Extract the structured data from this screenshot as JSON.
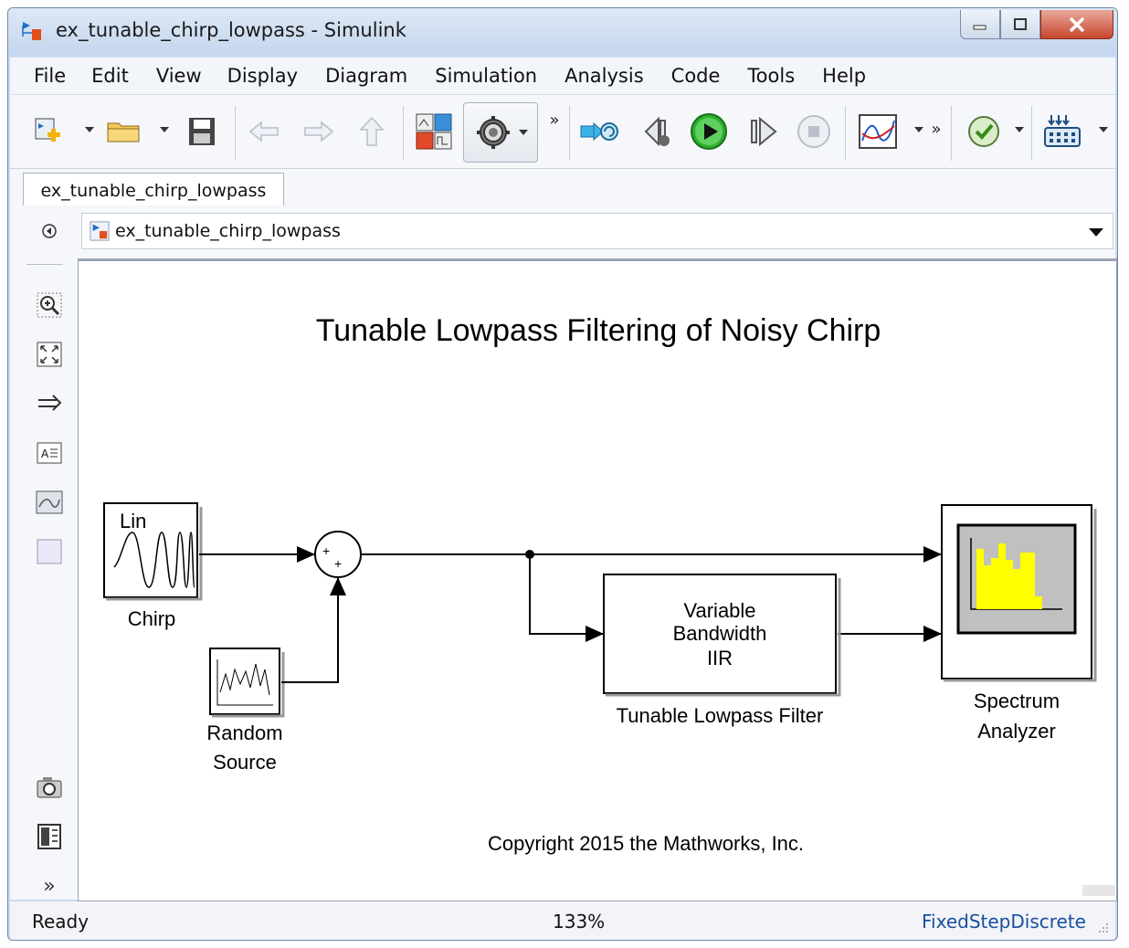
{
  "window": {
    "title": "ex_tunable_chirp_lowpass - Simulink"
  },
  "menu": [
    "File",
    "Edit",
    "View",
    "Display",
    "Diagram",
    "Simulation",
    "Analysis",
    "Code",
    "Tools",
    "Help"
  ],
  "toolbar": {
    "icons": [
      "new-model-icon",
      "open-folder-icon",
      "save-icon",
      "back-arrow-icon",
      "forward-arrow-icon",
      "up-arrow-icon",
      "library-browser-icon",
      "model-config-gear-icon",
      "more-icon",
      "step-back-icon",
      "run-icon",
      "step-forward-icon",
      "stop-icon",
      "data-inspector-icon",
      "more-icon",
      "model-advisor-icon",
      "build-icon"
    ],
    "overflow": "»"
  },
  "tab": {
    "label": "ex_tunable_chirp_lowpass"
  },
  "address": {
    "path": "ex_tunable_chirp_lowpass"
  },
  "palette": {
    "more": "»"
  },
  "diagram": {
    "title": "Tunable Lowpass Filtering of Noisy Chirp",
    "chirp": {
      "label": "Chirp",
      "inner": "Lin"
    },
    "random": {
      "label_line1": "Random",
      "label_line2": "Source"
    },
    "sum": {
      "signs": "++"
    },
    "filter": {
      "line1": "Variable",
      "line2": "Bandwidth",
      "line3": "IIR",
      "label": "Tunable Lowpass Filter"
    },
    "analyzer": {
      "label_line1": "Spectrum",
      "label_line2": "Analyzer"
    },
    "copyright": "Copyright 2015 the Mathworks, Inc."
  },
  "status": {
    "left": "Ready",
    "zoom": "133%",
    "solver": "FixedStepDiscrete"
  },
  "colors": {
    "accent_run": "#2bb02b",
    "analyzer_bars": "#ffff00",
    "close_red": "#c8452d"
  }
}
